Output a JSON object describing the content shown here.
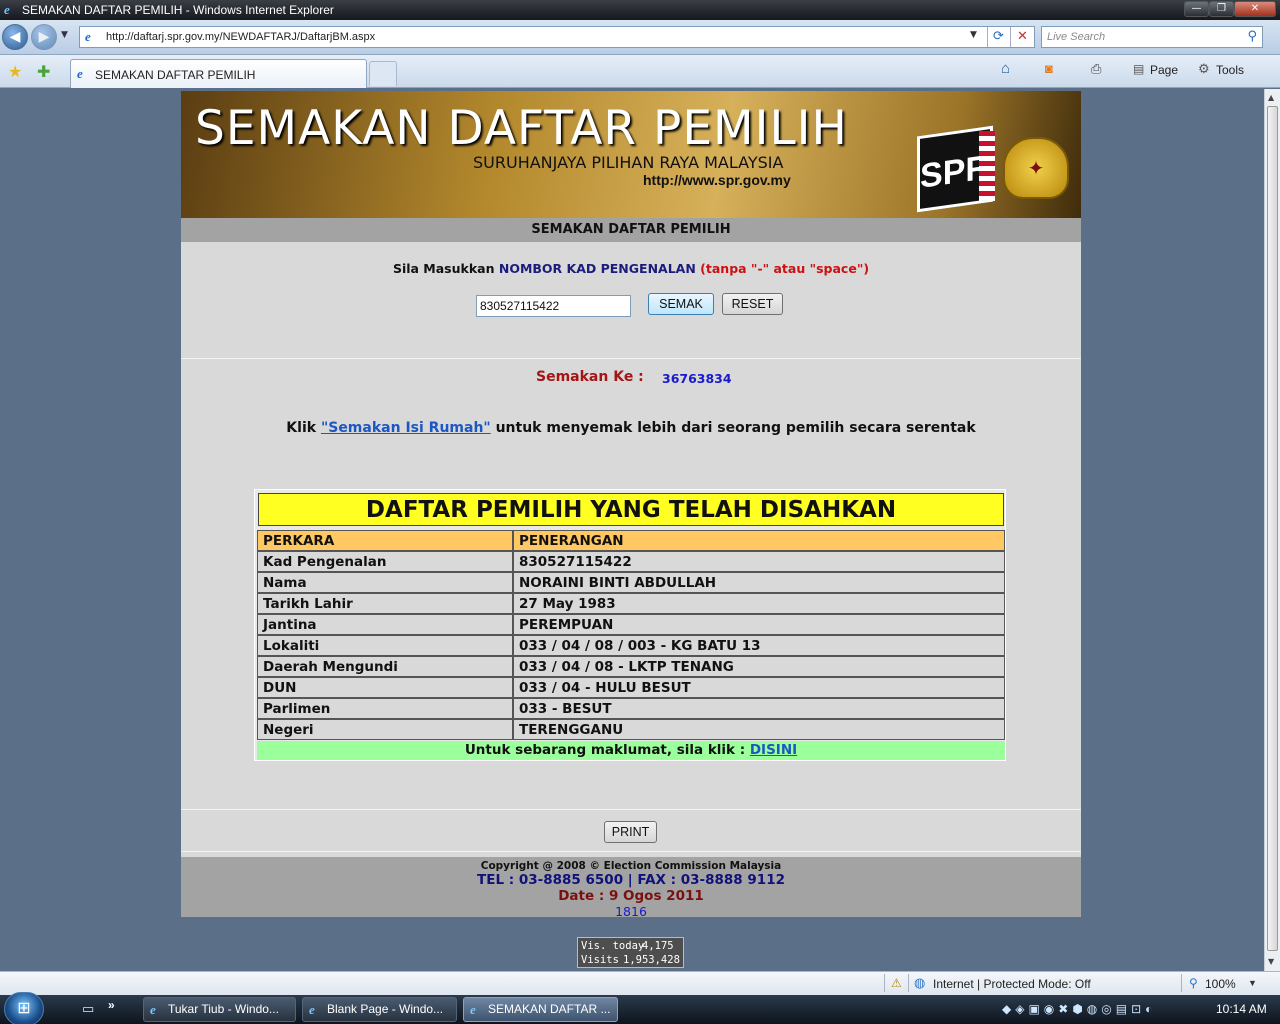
{
  "window": {
    "title": "SEMAKAN DAFTAR PEMILIH - Windows Internet Explorer",
    "minimize": "—",
    "maximize": "❐",
    "close": "✕"
  },
  "browser": {
    "url": "http://daftarj.spr.gov.my/NEWDAFTARJ/DaftarjBM.aspx",
    "search_placeholder": "Live Search",
    "tab_title": "SEMAKAN DAFTAR PEMILIH",
    "cmd_page": "Page",
    "cmd_tools": "Tools"
  },
  "banner": {
    "title": "SEMAKAN DAFTAR PEMILIH",
    "subtitle": "SURUHANJAYA PILIHAN RAYA MALAYSIA",
    "website": "http://www.spr.gov.my",
    "logo_text": "SPR"
  },
  "form": {
    "header": "SEMAKAN DAFTAR PEMILIH",
    "prompt_prefix": "Sila Masukkan",
    "prompt_field": "NOMBOR KAD PENGENALAN",
    "prompt_hint": "(tanpa \"-\" atau \"space\")",
    "ic_value": "830527115422",
    "semak_label": "SEMAK",
    "reset_label": "RESET"
  },
  "counter": {
    "label": "Semakan Ke :",
    "value": "36763834"
  },
  "household": {
    "prefix": "Klik",
    "link": "\"Semakan Isi Rumah\"",
    "suffix": "untuk menyemak lebih dari seorang pemilih secara serentak"
  },
  "result": {
    "title": "DAFTAR PEMILIH YANG TELAH DISAHKAN",
    "col1": "PERKARA",
    "col2": "PENERANGAN",
    "rows": [
      {
        "k": "Kad Pengenalan",
        "v": "830527115422"
      },
      {
        "k": "Nama",
        "v": "NORAINI BINTI ABDULLAH"
      },
      {
        "k": "Tarikh Lahir",
        "v": "27 May 1983"
      },
      {
        "k": "Jantina",
        "v": "PEREMPUAN"
      },
      {
        "k": "Lokaliti",
        "v": "033 / 04 / 08 / 003 - KG BATU 13"
      },
      {
        "k": "Daerah Mengundi",
        "v": "033 / 04 / 08 - LKTP TENANG"
      },
      {
        "k": "DUN",
        "v": "033 / 04 - HULU BESUT"
      },
      {
        "k": "Parlimen",
        "v": "033 - BESUT"
      },
      {
        "k": "Negeri",
        "v": "TERENGGANU"
      }
    ],
    "info_text": "Untuk sebarang maklumat, sila klik :",
    "info_link": "DISINI"
  },
  "print_label": "PRINT",
  "footer": {
    "copyright": "Copyright @ 2008 © Election Commission Malaysia",
    "tel": "TEL : 03-8885 6500 | FAX : 03-8888 9112",
    "date": "Date : 9 Ogos 2011",
    "number": "1816"
  },
  "visits": {
    "today_label": "Vis. today",
    "today_value": "4,175",
    "total_label": "Visits",
    "total_value": "1,953,428"
  },
  "statusbar": {
    "zone": "Internet | Protected Mode: Off",
    "zoom": "100%"
  },
  "taskbar": {
    "items": [
      {
        "label": "Tukar Tiub - Windo..."
      },
      {
        "label": "Blank Page - Windo..."
      },
      {
        "label": "SEMAKAN DAFTAR ..."
      }
    ],
    "clock": "10:14 AM"
  },
  "colors": {
    "page_bg": "#5b7088",
    "result_title_bg": "#ffff22",
    "result_header_bg": "#ffc862",
    "info_bg": "#9bff9b",
    "counter_label": "#a51515",
    "counter_value": "#1a1acc"
  },
  "icons": [
    "ie-icon",
    "back-arrow-icon",
    "forward-arrow-icon",
    "refresh-icon",
    "stop-icon",
    "search-icon",
    "favorites-star-icon",
    "add-favorites-icon",
    "home-icon",
    "feeds-icon",
    "print-icon",
    "page-icon",
    "tools-gear-icon",
    "globe-icon",
    "zoom-icon",
    "start-orb-icon"
  ]
}
